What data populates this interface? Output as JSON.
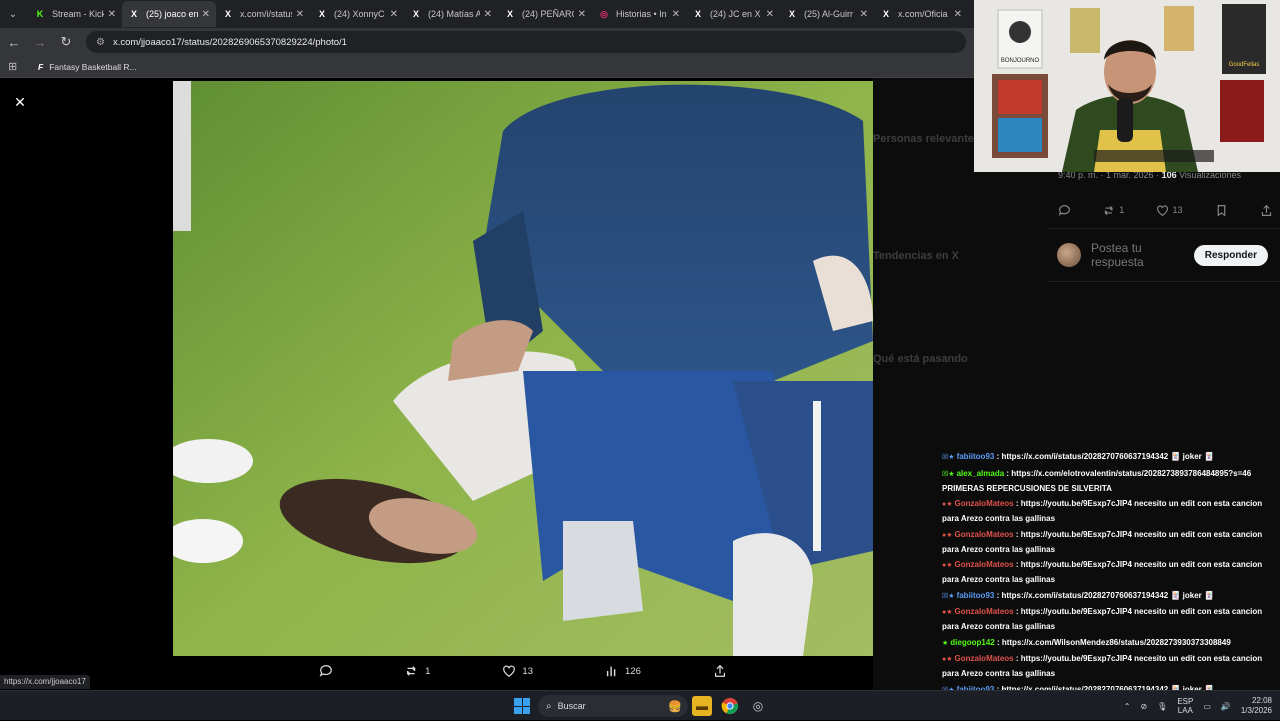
{
  "tabs": [
    {
      "label": "Stream - Kick",
      "favicon": "K",
      "color": "#53fc18",
      "active": false
    },
    {
      "label": "(25) joaco en X",
      "favicon": "X",
      "color": "#ffffff",
      "active": true
    },
    {
      "label": "x.com/i/status",
      "favicon": "X",
      "color": "#ffffff",
      "active": false
    },
    {
      "label": "(24) XonnyC",
      "favicon": "X",
      "color": "#ffffff",
      "active": false
    },
    {
      "label": "(24) Matías A",
      "favicon": "X",
      "color": "#ffffff",
      "active": false
    },
    {
      "label": "(24) PEÑARO",
      "favicon": "X",
      "color": "#ffffff",
      "active": false
    },
    {
      "label": "Historias • In",
      "favicon": "◎",
      "color": "#e1306c",
      "active": false
    },
    {
      "label": "(24) JC en X",
      "favicon": "X",
      "color": "#ffffff",
      "active": false
    },
    {
      "label": "(25) Al-Guirr",
      "favicon": "X",
      "color": "#ffffff",
      "active": false
    },
    {
      "label": "x.com/Oficia",
      "favicon": "X",
      "color": "#ffffff",
      "active": false
    }
  ],
  "address": {
    "url": "x.com/jjoaaco17/status/2028269065370829224/photo/1"
  },
  "bookmarks": [
    {
      "label": "Fantasy Basketball R..."
    }
  ],
  "photo_actions": {
    "reply_count": "",
    "retweet_count": "1",
    "like_count": "13",
    "view_count": "126"
  },
  "tweet": {
    "meta_time": "9:40 p. m. · 1 mar. 2026 · ",
    "meta_views": "106",
    "meta_views_label": " Visualizaciones",
    "retweets": "1",
    "likes": "13",
    "reply_placeholder": "Postea tu respuesta",
    "reply_button": "Responder"
  },
  "sidebar_ghost": {
    "relevant": "Personas relevantes",
    "happening": "Qué está pasando",
    "whats_x": "Tendencias en X"
  },
  "chat": [
    {
      "user": "fabiitoo93",
      "color": "#5b9cf5",
      "badges": "☒★",
      "text": "https://x.com/i/status/2028270760637194342 🃏 joker 🃏"
    },
    {
      "user": "alex_almada",
      "color": "#53fc18",
      "badges": "☒★",
      "text": "https://x.com/elotrovalentin/status/2028273893786484895?s=46 PRIMERAS REPERCUSIONES DE SILVERITA"
    },
    {
      "user": "GonzaloMateos",
      "color": "#e0524b",
      "badges": "●★",
      "text": "https://youtu.be/9Esxp7cJIP4 necesito un edit con esta cancion para Arezo contra las gallinas"
    },
    {
      "user": "GonzaloMateos",
      "color": "#e0524b",
      "badges": "●★",
      "text": "https://youtu.be/9Esxp7cJIP4 necesito un edit con esta cancion para Arezo contra las gallinas"
    },
    {
      "user": "GonzaloMateos",
      "color": "#e0524b",
      "badges": "●★",
      "text": "https://youtu.be/9Esxp7cJIP4 necesito un edit con esta cancion para Arezo contra las gallinas"
    },
    {
      "user": "fabiitoo93",
      "color": "#5b9cf5",
      "badges": "☒★",
      "text": "https://x.com/i/status/2028270760637194342 🃏 joker 🃏"
    },
    {
      "user": "GonzaloMateos",
      "color": "#e0524b",
      "badges": "●★",
      "text": "https://youtu.be/9Esxp7cJIP4 necesito un edit con esta cancion para Arezo contra las gallinas"
    },
    {
      "user": "diegoop142",
      "color": "#53fc18",
      "badges": "★",
      "text": "https://x.com/WilsonMendez86/status/2028273930373308849"
    },
    {
      "user": "GonzaloMateos",
      "color": "#e0524b",
      "badges": "●★",
      "text": "https://youtu.be/9Esxp7cJIP4 necesito un edit con esta cancion para Arezo contra las gallinas"
    },
    {
      "user": "fabiitoo93",
      "color": "#5b9cf5",
      "badges": "☒★",
      "text": "https://x.com/i/status/2028270760637194342 🃏 joker 🃏"
    }
  ],
  "status_url": "https://x.com/jjoaaco17",
  "taskbar": {
    "search_label": "Buscar",
    "lang_top": "ESP",
    "lang_bottom": "LAA",
    "time": "22:08",
    "date": "1/3/2026"
  },
  "webcam": {
    "poster_1": "BONJOURNO",
    "poster_2": "GoodFellas"
  }
}
